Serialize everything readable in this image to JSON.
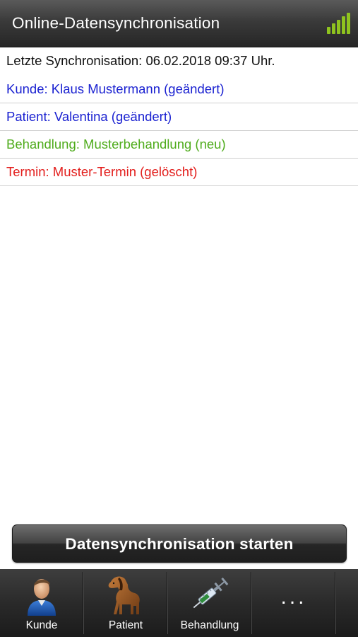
{
  "header": {
    "title": "Online-Datensynchronisation",
    "signal_icon": "signal-strength-icon",
    "signal_color": "#8fc31f"
  },
  "sync": {
    "last_sync": "Letzte Synchronisation: 06.02.2018 09:37 Uhr.",
    "items": [
      {
        "text": "Kunde: Klaus Mustermann (geändert)",
        "status": "changed",
        "color": "#1b22d1"
      },
      {
        "text": "Patient: Valentina (geändert)",
        "status": "changed",
        "color": "#1b22d1"
      },
      {
        "text": "Behandlung: Musterbehandlung (neu)",
        "status": "new",
        "color": "#4fac1c"
      },
      {
        "text": "Termin: Muster-Termin (gelöscht)",
        "status": "deleted",
        "color": "#e3201e"
      }
    ]
  },
  "actions": {
    "start_label": "Datensynchronisation starten"
  },
  "tabbar": {
    "tabs": [
      {
        "label": "Kunde",
        "icon": "person-icon"
      },
      {
        "label": "Patient",
        "icon": "horse-icon"
      },
      {
        "label": "Behandlung",
        "icon": "syringe-icon"
      },
      {
        "label": "",
        "icon": "more-icon",
        "glyph": "..."
      }
    ]
  }
}
